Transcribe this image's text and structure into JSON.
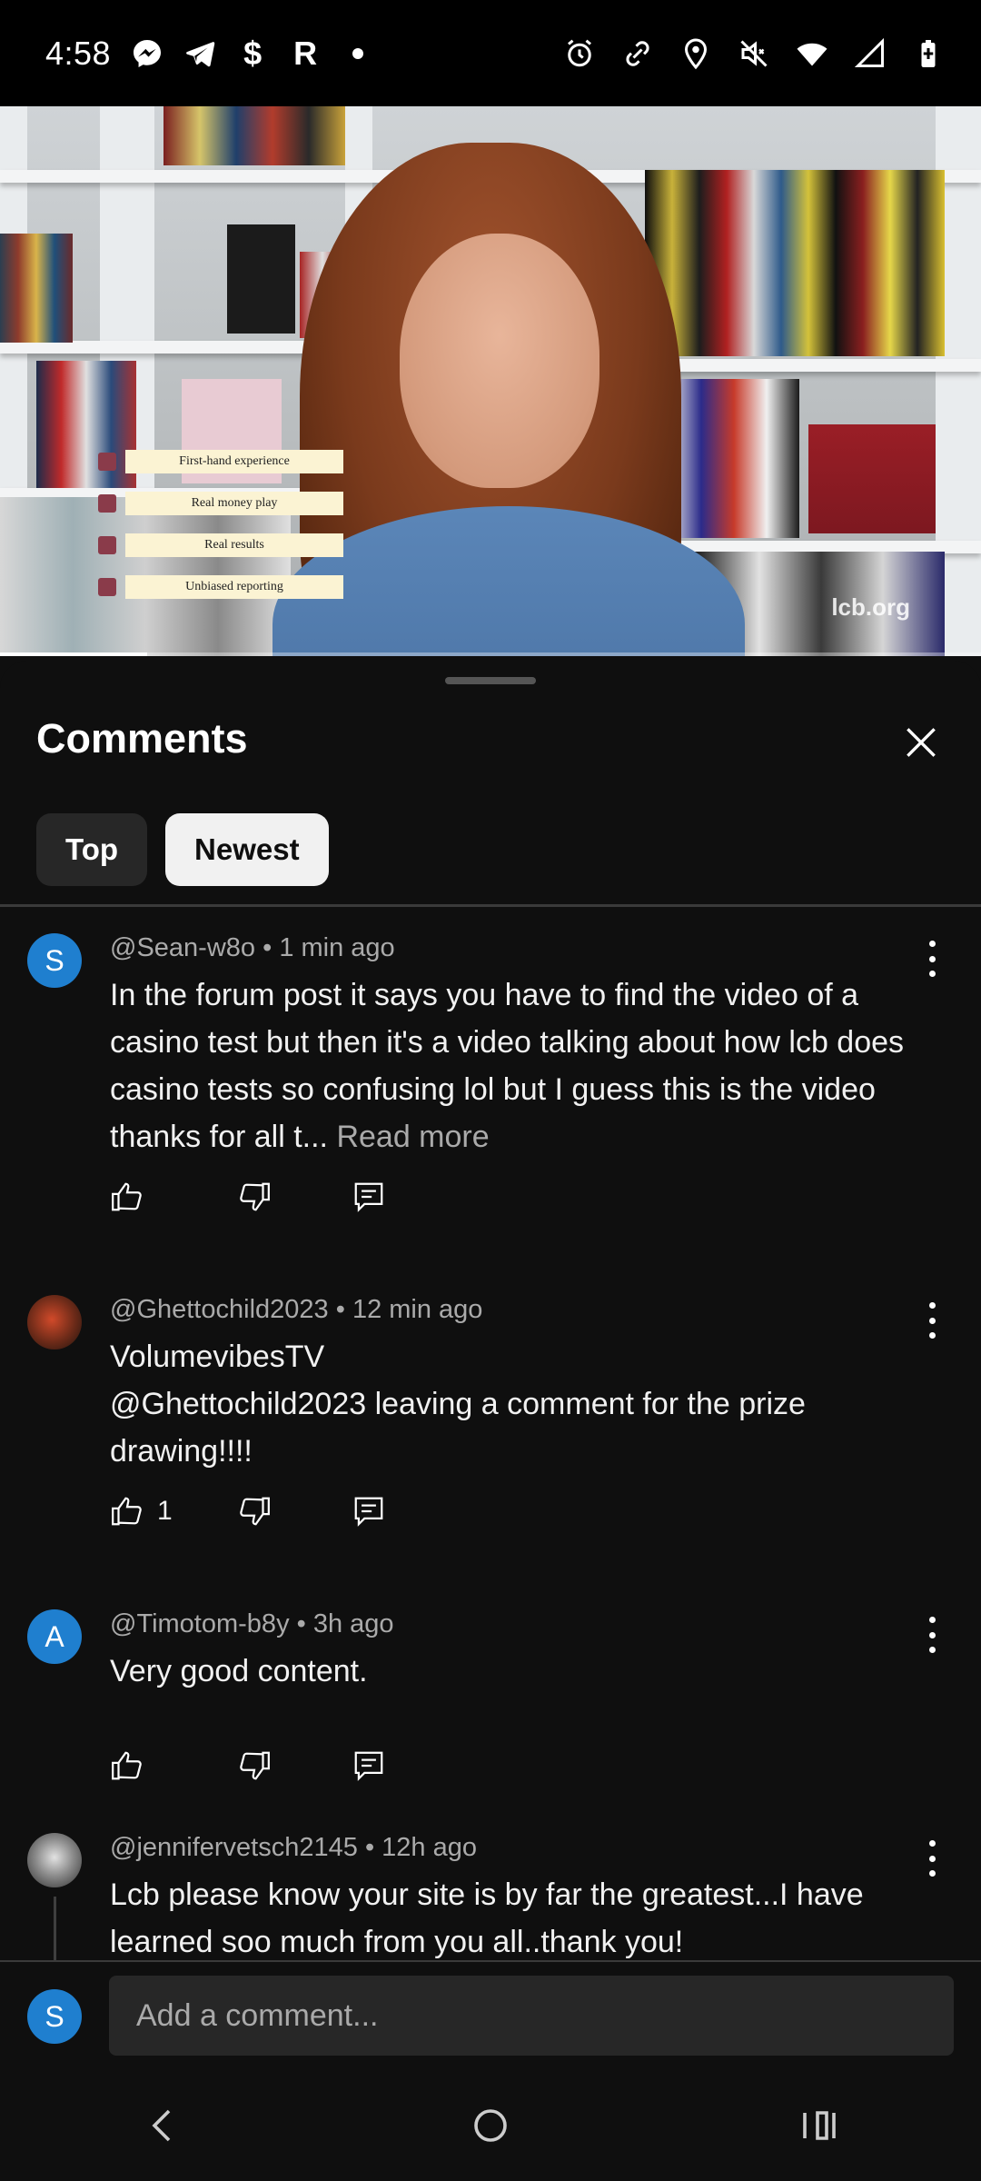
{
  "status_bar": {
    "time": "4:58",
    "left_icons": [
      "messenger-icon",
      "telegram-icon",
      "dollar-icon",
      "r-app-icon",
      "dot-icon"
    ],
    "dollar_glyph": "$",
    "r_glyph": "R",
    "right_icons": [
      "alarm-icon",
      "link-icon",
      "location-icon",
      "mute-icon",
      "wifi-icon",
      "signal-icon",
      "battery-charging-icon"
    ]
  },
  "video": {
    "overlay_items": [
      "First-hand experience",
      "Real money play",
      "Real results",
      "Unbiased reporting"
    ],
    "watermark": "lcb.org",
    "progress": 0.15
  },
  "comments_sheet": {
    "title": "Comments",
    "filters": [
      {
        "label": "Top",
        "selected": false
      },
      {
        "label": "Newest",
        "selected": true
      }
    ],
    "comments": [
      {
        "author": "@Sean-w8o",
        "time": "1 min ago",
        "avatar_letter": "S",
        "text": "In the forum post it says you have to find the video of a casino test but then it's a video talking about how lcb does casino tests so confusing lol but I guess this is the video thanks for all t...",
        "read_more": "Read more",
        "likes": ""
      },
      {
        "author": "@Ghettochild2023",
        "time": "12 min ago",
        "avatar_letter": "",
        "text": "VolumevibesTV\n@Ghettochild2023   leaving a comment for the prize drawing!!!!",
        "likes": "1"
      },
      {
        "author": "@Timotom-b8y",
        "time": "3h ago",
        "avatar_letter": "A",
        "text": "Very good content.",
        "likes": ""
      },
      {
        "author": "@jennifervetsch2145",
        "time": "12h ago",
        "avatar_letter": "",
        "text": "Lcb please know your site is by far the greatest...I have learned soo much from you all..thank you!",
        "likes": ""
      }
    ],
    "composer": {
      "avatar_letter": "S",
      "placeholder": "Add a comment..."
    }
  },
  "nav_bar": {
    "buttons": [
      "back-icon",
      "home-icon",
      "recents-icon"
    ]
  },
  "colors": {
    "background": "#0f0f0f",
    "avatar_blue": "#1f7fcf",
    "chip_active_bg": "#f1f1f1",
    "chip_inactive_bg": "#272727",
    "meta_text": "#aaaaaa"
  }
}
